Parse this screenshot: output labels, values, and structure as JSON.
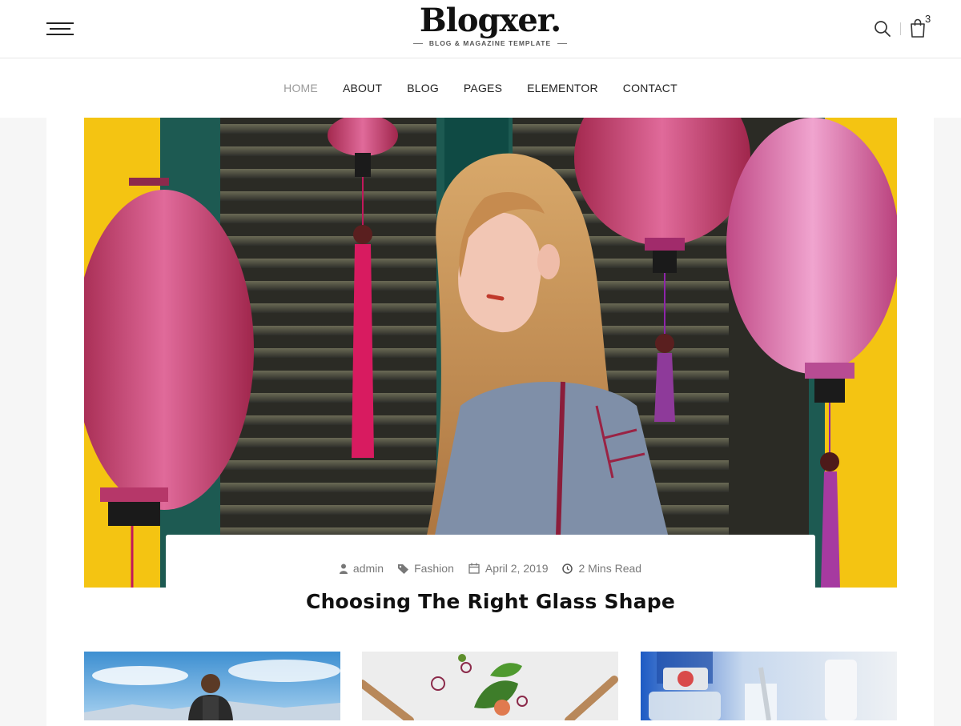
{
  "header": {
    "logo_text": "Blogxer.",
    "logo_tagline": "BLOG & MAGAZINE TEMPLATE",
    "cart_count": "3",
    "icons": [
      "menu-icon",
      "search-icon",
      "shopping-bag-icon"
    ]
  },
  "nav": {
    "items": [
      {
        "label": "HOME",
        "active": true
      },
      {
        "label": "ABOUT",
        "active": false
      },
      {
        "label": "BLOG",
        "active": false
      },
      {
        "label": "PAGES",
        "active": false
      },
      {
        "label": "ELEMENTOR",
        "active": false
      },
      {
        "label": "CONTACT",
        "active": false
      }
    ]
  },
  "featured_post": {
    "author": "admin",
    "category": "Fashion",
    "date": "April 2, 2019",
    "read_time": "2 Mins Read",
    "title": "Choosing The Right Glass Shape",
    "image": "woman-with-lanterns-photo"
  },
  "thumbnails": [
    {
      "image": "hiker-mountain-photo"
    },
    {
      "image": "salad-ingredients-photo"
    },
    {
      "image": "lab-bottles-photo"
    }
  ],
  "colors": {
    "nav_active": "#9a9a9a",
    "text": "#222222",
    "meta": "#7a7a7a",
    "page_bg": "#f6f6f6"
  }
}
